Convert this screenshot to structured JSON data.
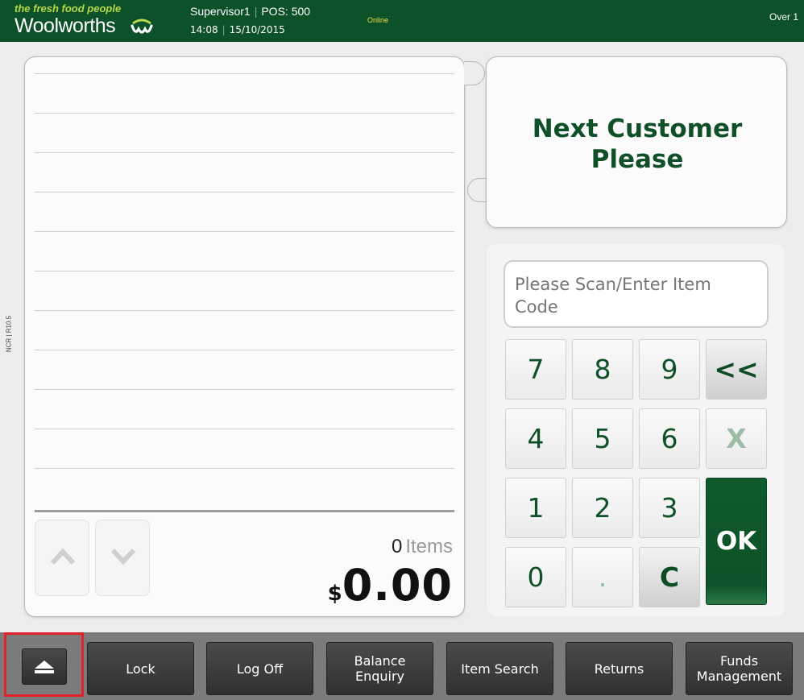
{
  "header": {
    "tagline": "the fresh food people",
    "brand": "Woolworths",
    "logo_icon": "woolworths-w-logo-icon",
    "operator": "Supervisor1",
    "pos": "POS: 500",
    "time": "14:08",
    "date": "15/10/2015",
    "status": "Online",
    "right_text": "Over 1"
  },
  "side_label": "NCR | R10.5",
  "receipt": {
    "items_count": "0",
    "items_label": "Items",
    "currency": "$",
    "total": "0.00",
    "scroll_up_icon": "chevron-up-icon",
    "scroll_down_icon": "chevron-down-icon"
  },
  "message": {
    "text": "Next Customer Please"
  },
  "entry": {
    "placeholder": "Please Scan/Enter Item Code"
  },
  "keypad": {
    "k7": "7",
    "k8": "8",
    "k9": "9",
    "back": "<<",
    "k4": "4",
    "k5": "5",
    "k6": "6",
    "x": "X",
    "k1": "1",
    "k2": "2",
    "k3": "3",
    "ok": "OK",
    "k0": "0",
    "dot": ".",
    "clear": "C"
  },
  "toolbar": {
    "eject_icon": "eject-icon",
    "lock": "Lock",
    "logoff": "Log Off",
    "balance": "Balance\nEnquiry",
    "item_search": "Item Search",
    "returns": "Returns",
    "funds": "Funds\nManagement"
  },
  "colors": {
    "brand_green": "#0d5128",
    "tagline_lime": "#b8d84a",
    "status_yellow": "#f2e04a",
    "highlight_red": "#e2212b",
    "toolbar_grey": "#7b7b7b"
  }
}
